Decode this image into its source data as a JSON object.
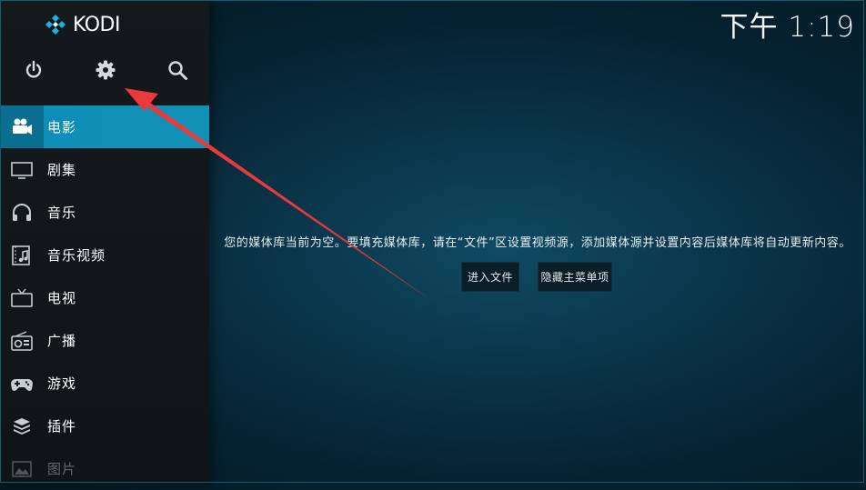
{
  "app": {
    "logo_text": "KODI",
    "clock": "下午 1:19"
  },
  "top_buttons": [
    {
      "name": "power-icon"
    },
    {
      "name": "gear-icon"
    },
    {
      "name": "search-icon"
    }
  ],
  "menu": [
    {
      "label": "电影",
      "icon": "movie-camera-icon",
      "active": true
    },
    {
      "label": "剧集",
      "icon": "tv-monitor-icon"
    },
    {
      "label": "音乐",
      "icon": "headphones-icon"
    },
    {
      "label": "音乐视频",
      "icon": "music-video-icon"
    },
    {
      "label": "电视",
      "icon": "television-icon"
    },
    {
      "label": "广播",
      "icon": "radio-icon"
    },
    {
      "label": "游戏",
      "icon": "gamepad-icon"
    },
    {
      "label": "插件",
      "icon": "addons-box-icon"
    },
    {
      "label": "图片",
      "icon": "picture-icon",
      "dim": true
    }
  ],
  "main": {
    "message": "您的媒体库当前为空。要填充媒体库，请在“文件”区设置视频源，添加媒体源并设置内容后媒体库将自动更新内容。",
    "buttons": [
      "进入文件",
      "隐藏主菜单项"
    ]
  },
  "colors": {
    "accent": "#12a4d3",
    "annotation_arrow": "#e8393b"
  }
}
